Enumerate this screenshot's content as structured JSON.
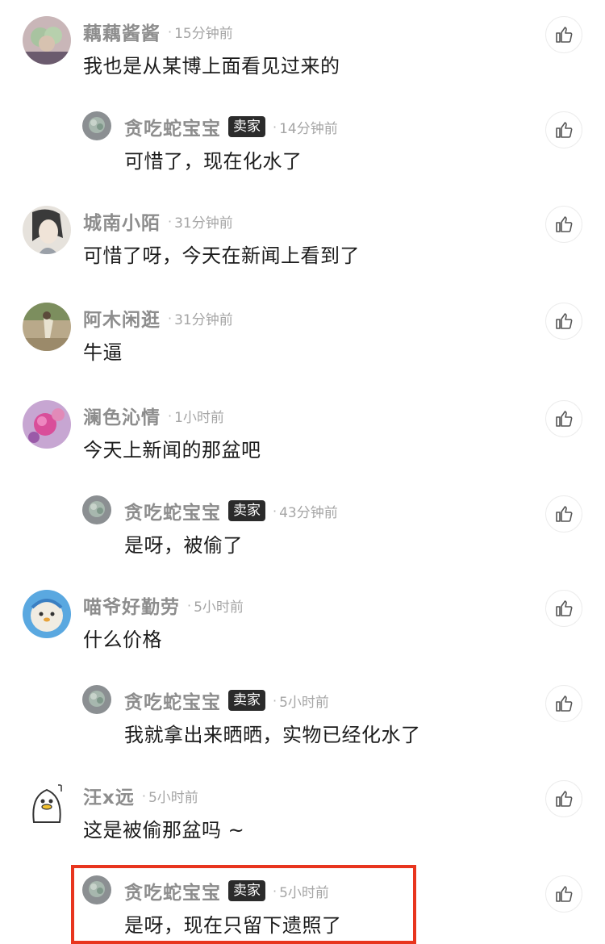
{
  "comments": [
    {
      "name": "藕藕酱酱",
      "time": "15分钟前",
      "text": "我也是从某博上面看见过来的"
    },
    {
      "name": "贪吃蛇宝宝",
      "badge": "卖家",
      "time": "14分钟前",
      "text": "可惜了，现在化水了"
    },
    {
      "name": "城南小陌",
      "time": "31分钟前",
      "text": "可惜了呀，今天在新闻上看到了"
    },
    {
      "name": "阿木闲逛",
      "time": "31分钟前",
      "text": "牛逼"
    },
    {
      "name": "澜色沁情",
      "time": "1小时前",
      "text": "今天上新闻的那盆吧"
    },
    {
      "name": "贪吃蛇宝宝",
      "badge": "卖家",
      "time": "43分钟前",
      "text": "是呀，被偷了"
    },
    {
      "name": "喵爷好勤劳",
      "time": "5小时前",
      "text": "什么价格"
    },
    {
      "name": "贪吃蛇宝宝",
      "badge": "卖家",
      "time": "5小时前",
      "text": "我就拿出来晒晒，实物已经化水了"
    },
    {
      "name": "汪x远",
      "time": "5小时前",
      "text": "这是被偷那盆吗 ~"
    },
    {
      "name": "贪吃蛇宝宝",
      "badge": "卖家",
      "time": "5小时前",
      "text": "是呀，现在只留下遗照了"
    }
  ],
  "separator": "·",
  "colors": {
    "highlight": "#e8351e",
    "badge_bg": "#2b2b2b",
    "name": "#8d8d8d"
  },
  "icons": {
    "like": "thumbs-up-icon"
  }
}
